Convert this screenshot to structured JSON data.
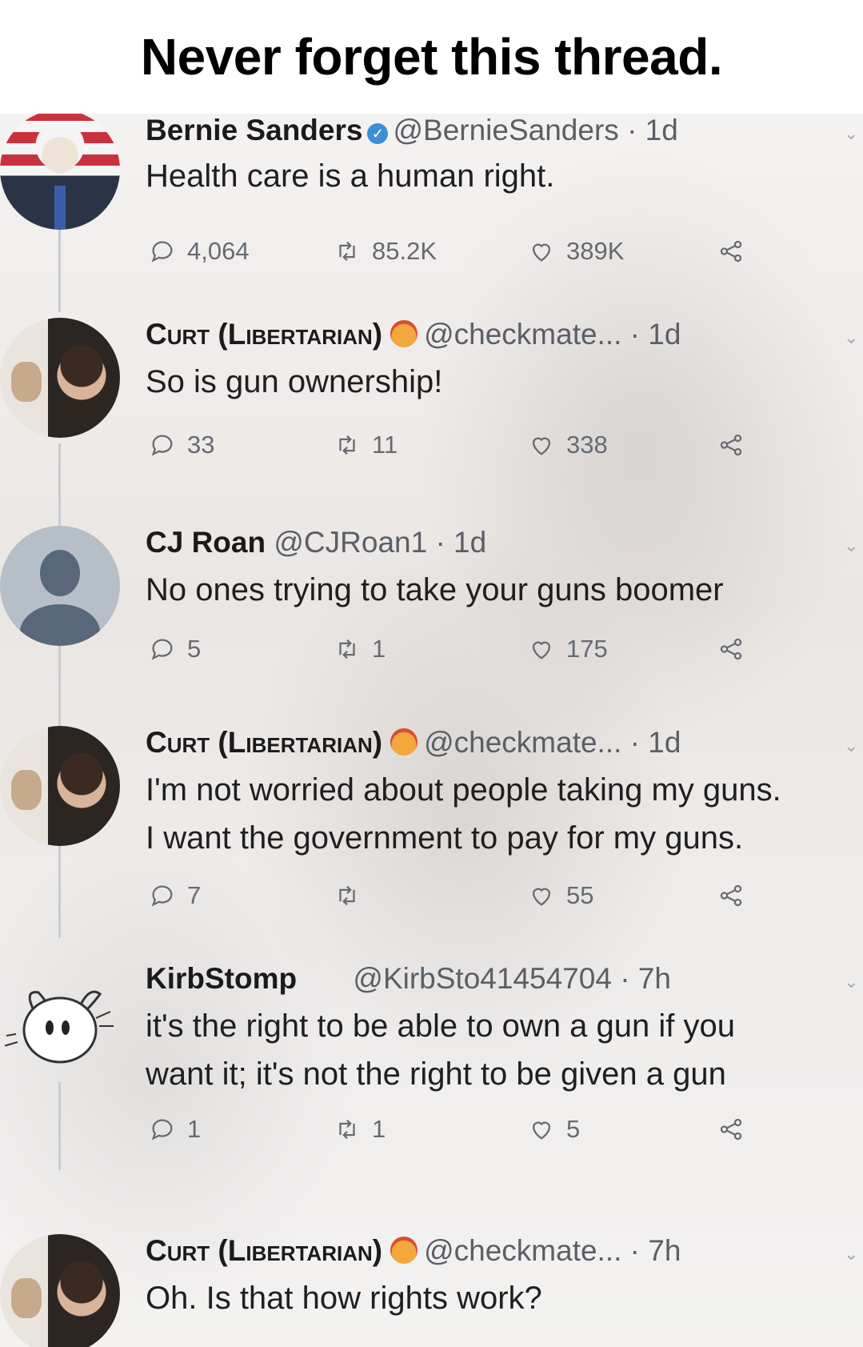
{
  "meme": {
    "title": "Never forget this thread."
  },
  "icons": {
    "reply": "reply-bubble-icon",
    "retweet": "retweet-icon",
    "like": "heart-icon",
    "share": "share-icon",
    "verified": "verified-badge-icon",
    "emoji": "angry-emoji-icon",
    "more": "chevron-down-icon"
  },
  "tweets": [
    {
      "name": "Bernie Sanders",
      "handle": "@BernieSanders",
      "time": "· 1d",
      "lines": [
        "Health care is a human right."
      ],
      "replies": "4,064",
      "retweets": "85.2K",
      "likes": "389K"
    },
    {
      "name": "Curt (Libertarian)",
      "handle": "@checkmate...",
      "time": "· 1d",
      "lines": [
        "So is gun ownership!"
      ],
      "replies": "33",
      "retweets": "11",
      "likes": "338"
    },
    {
      "name": "CJ Roan",
      "handle": "@CJRoan1",
      "time": "· 1d",
      "lines": [
        "No ones trying to take your guns boomer"
      ],
      "replies": "5",
      "retweets": "1",
      "likes": "175"
    },
    {
      "name": "Curt (Libertarian)",
      "handle": "@checkmate...",
      "time": "· 1d",
      "lines": [
        "I'm not worried about people taking my guns.",
        "I want the government to pay for my guns."
      ],
      "replies": "7",
      "retweets": "",
      "likes": "55"
    },
    {
      "name": "KirbStomp",
      "handle": "@KirbSto41454704",
      "time": "· 7h",
      "lines": [
        "it's the right to be able to own a gun if you",
        "want it; it's not the right to be given a gun"
      ],
      "replies": "1",
      "retweets": "1",
      "likes": "5"
    },
    {
      "name": "Curt (Libertarian)",
      "handle": "@checkmate...",
      "time": "· 7h",
      "lines": [
        "Oh. Is that how rights work?"
      ]
    }
  ]
}
